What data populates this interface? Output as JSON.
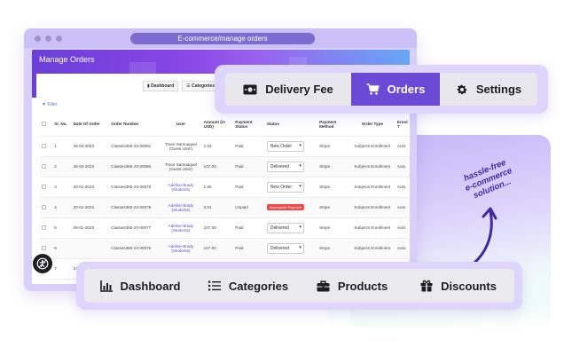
{
  "window": {
    "url": "E-commerce/manage orders",
    "page_title": "Manage Orders"
  },
  "mini_tabs": [
    "Dashboard",
    "Categories"
  ],
  "filter_label": "Filter",
  "table": {
    "headers": [
      "Sr. No.",
      "Date Of Order",
      "Order Number",
      "User",
      "Amount (in USD)",
      "Payment Status",
      "Status",
      "Payment Method",
      "Order Type",
      "Enrol T"
    ],
    "rows": [
      {
        "sr": "1",
        "date": "29-03-2023",
        "order": "Classes365-23-00081",
        "user": "Trace Samuaquel (Guest User)",
        "user_link": false,
        "amount": "1.03",
        "payment": "Paid",
        "status_type": "select",
        "status": "New Order",
        "method": "Stripe",
        "type": "Subjects Enrollment",
        "enrol": "Auto"
      },
      {
        "sr": "2",
        "date": "28-03-2023",
        "order": "Classes365-23-00080",
        "user": "Trace Samuaquel (Guest User)",
        "user_link": false,
        "amount": "107.00",
        "payment": "Paid",
        "status_type": "select",
        "status": "Delivered",
        "method": "Stripe",
        "type": "Subjects Enrollment",
        "enrol": "Auto"
      },
      {
        "sr": "3",
        "date": "20-01-2023",
        "order": "Classes365-23-00079",
        "user": "Adeline Brady (Students)",
        "user_link": true,
        "amount": "1.55",
        "payment": "Paid",
        "status_type": "select",
        "status": "New Order",
        "method": "Stripe",
        "type": "Subjects Enrollment",
        "enrol": "Auto"
      },
      {
        "sr": "4",
        "date": "20-01-2023",
        "order": "Classes365-23-00078",
        "user": "Adeline Brady (Students)",
        "user_link": true,
        "amount": "0.01",
        "payment": "Unpaid",
        "status_type": "badge",
        "status": "Incomplete Payment",
        "method": "Stripe",
        "type": "Subjects Enrollment",
        "enrol": "Auto"
      },
      {
        "sr": "5",
        "date": "09-01-2023",
        "order": "Classes365-23-00077",
        "user": "Adeline Brady (Students)",
        "user_link": true,
        "amount": "107.00",
        "payment": "Paid",
        "status_type": "select",
        "status": "Delivered",
        "method": "Stripe",
        "type": "Subjects Enrollment",
        "enrol": "Auto"
      },
      {
        "sr": "6",
        "date": "",
        "order": "Classes365-23-00076",
        "user": "Adeline Brady (Students)",
        "user_link": true,
        "amount": "107.00",
        "payment": "Paid",
        "status_type": "select",
        "status": "Delivered",
        "method": "Stripe",
        "type": "Subjects Enrollment",
        "enrol": "Auto"
      },
      {
        "sr": "7",
        "date": "21-1",
        "order": "",
        "user": "",
        "user_link": false,
        "amount": "",
        "payment": "",
        "status_type": "none",
        "status": "",
        "method": "",
        "type": "",
        "enrol": ""
      }
    ]
  },
  "top_tabs": [
    {
      "label": "Delivery Fee",
      "icon": "money-bill-icon",
      "active": false
    },
    {
      "label": "Orders",
      "icon": "cart-icon",
      "active": true
    },
    {
      "label": "Settings",
      "icon": "gear-icon",
      "active": false
    }
  ],
  "bottom_tabs": [
    {
      "label": "Dashboard",
      "icon": "bar-chart-icon"
    },
    {
      "label": "Categories",
      "icon": "list-icon"
    },
    {
      "label": "Products",
      "icon": "briefcase-icon"
    },
    {
      "label": "Discounts",
      "icon": "gift-icon"
    }
  ],
  "tagline": [
    "hassle-free",
    "e-commerce",
    "solution..."
  ],
  "colors": {
    "accent": "#6b4bd6",
    "header_gradient_start": "#6a3fd8",
    "header_gradient_end": "#67a8f5",
    "badge_red": "#f2474b"
  }
}
